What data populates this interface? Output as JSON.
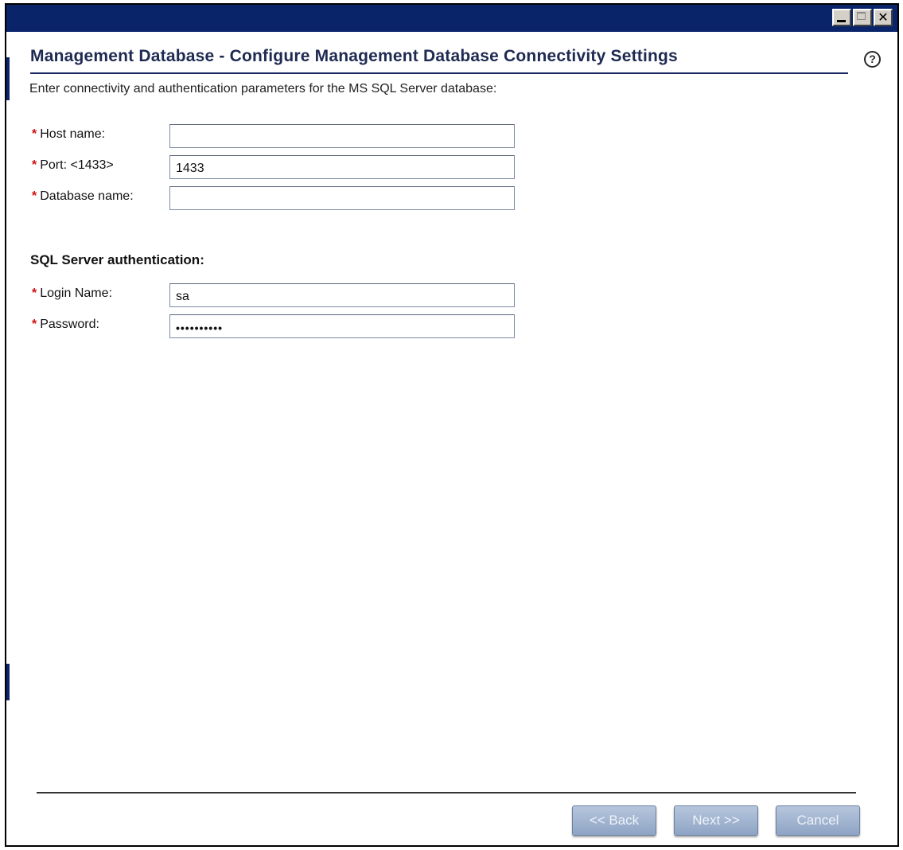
{
  "window": {
    "controls": [
      "minimize-icon",
      "maximize-icon",
      "close-icon"
    ],
    "close_glyph": "✕"
  },
  "header": {
    "title": "Management Database - Configure Management Database Connectivity Settings",
    "help_glyph": "?"
  },
  "instructions": "Enter connectivity and authentication parameters for the MS SQL Server database:",
  "required_marker": "*",
  "connection": {
    "host": {
      "label": "Host name:",
      "value": ""
    },
    "port": {
      "label": "Port: <1433>",
      "value": "1433"
    },
    "database": {
      "label": "Database name:",
      "value": ""
    }
  },
  "auth": {
    "heading": "SQL Server authentication:",
    "login": {
      "label": "Login Name:",
      "value": "sa"
    },
    "password": {
      "label": "Password:",
      "value": "••••••••••"
    }
  },
  "buttons": {
    "back": "<< Back",
    "next": "Next >>",
    "cancel": "Cancel"
  },
  "colors": {
    "titlebar": "#0a246a",
    "title_text": "#1e2a52",
    "required": "#cc1010",
    "button_fill": "#9fb3d0"
  }
}
